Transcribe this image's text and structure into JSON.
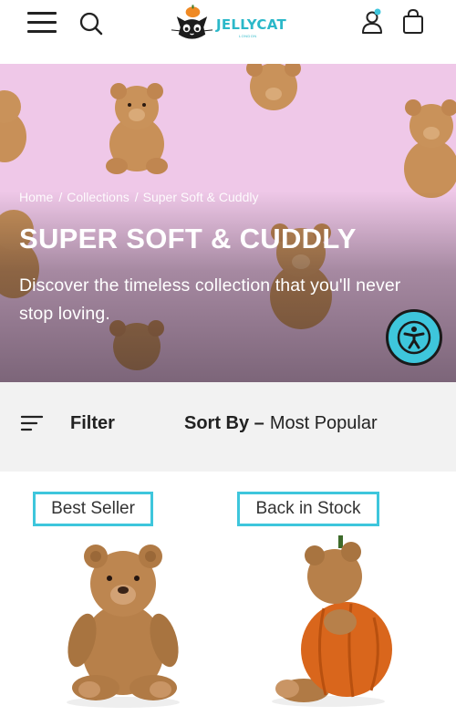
{
  "header": {
    "logo_text": "JELLYCAT",
    "logo_sub": "LONDON",
    "account_has_notification": true
  },
  "hero": {
    "breadcrumb": [
      "Home",
      "Collections",
      "Super Soft & Cuddly"
    ],
    "breadcrumb_separator": "/",
    "title": "SUPER SOFT & CUDDLY",
    "description": "Discover the timeless collection that you'll never stop loving.",
    "background_color": "#efc8e8"
  },
  "toolbar": {
    "filter_label": "Filter",
    "sort_label": "Sort By –",
    "sort_value": "Most Popular"
  },
  "products": [
    {
      "badge": "Best Seller",
      "image": "brown-teddy-bear"
    },
    {
      "badge": "Back in Stock",
      "image": "teddy-bear-in-pumpkin"
    }
  ],
  "colors": {
    "accent": "#3ec6dc",
    "brand": "#2bb8c9",
    "toolbar_bg": "#f2f2f2"
  }
}
